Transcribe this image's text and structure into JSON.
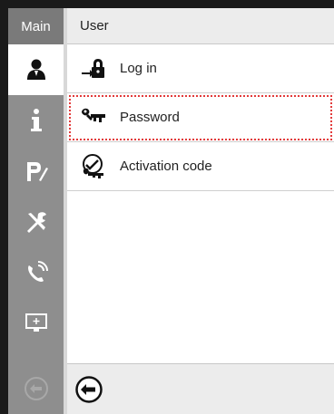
{
  "sidebar": {
    "header_label": "Main",
    "items": [
      {
        "icon": "user-icon",
        "active": true
      },
      {
        "icon": "info-icon",
        "active": false
      },
      {
        "icon": "program-icon",
        "active": false
      },
      {
        "icon": "tools-icon",
        "active": false
      },
      {
        "icon": "service-phone-icon",
        "active": false
      },
      {
        "icon": "display-icon",
        "active": false
      }
    ],
    "back_icon": "back-arrow-icon"
  },
  "main": {
    "title": "User",
    "items": [
      {
        "label": "Log in",
        "icon": "login-lock-icon",
        "selected": false
      },
      {
        "label": "Password",
        "icon": "password-key-icon",
        "selected": true
      },
      {
        "label": "Activation code",
        "icon": "activation-code-icon",
        "selected": false
      }
    ],
    "back_icon": "back-arrow-icon"
  },
  "colors": {
    "sidebar": "#8e8e8e",
    "header": "#ececec",
    "selection_outline": "#e23a3a"
  }
}
